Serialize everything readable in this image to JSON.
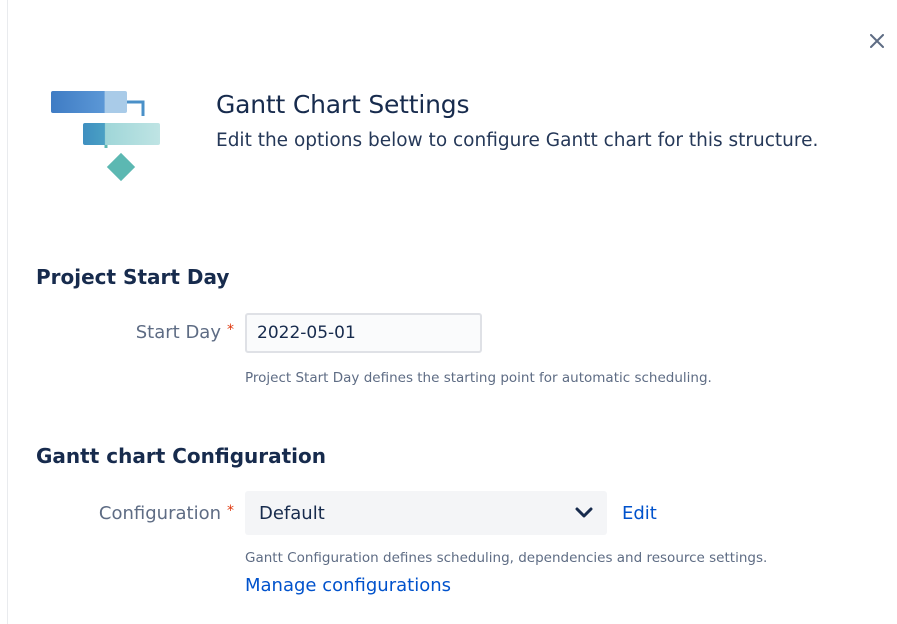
{
  "dialog": {
    "close_icon": "close-icon",
    "logo_icon": "gantt-chart-icon",
    "title": "Gantt Chart Settings",
    "subtitle": "Edit the options below to configure Gantt chart for this structure."
  },
  "project_start": {
    "heading": "Project Start Day",
    "label": "Start Day",
    "required_mark": "*",
    "value": "2022-05-01",
    "help": "Project Start Day defines the starting point for automatic scheduling."
  },
  "gantt_config": {
    "heading": "Gantt chart Configuration",
    "label": "Configuration",
    "required_mark": "*",
    "selected": "Default",
    "edit_link": "Edit",
    "help": "Gantt Configuration defines scheduling, dependencies and resource settings.",
    "manage_link": "Manage configurations"
  },
  "colors": {
    "accent": "#0052cc",
    "required": "#de350b",
    "logo_blue": "#4a86c8",
    "logo_teal": "#5cb8b2"
  }
}
